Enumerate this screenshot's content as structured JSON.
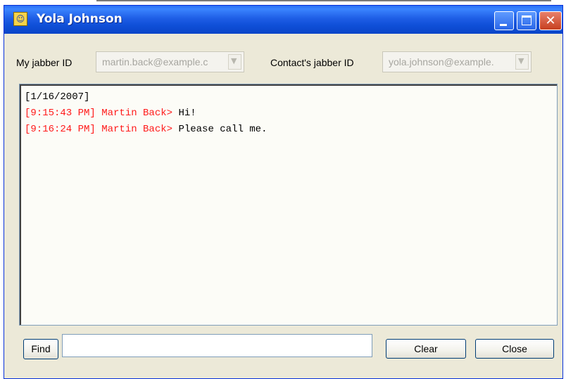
{
  "window": {
    "title": "Yola Johnson"
  },
  "fields": {
    "my_id_label": "My jabber ID",
    "my_id_value": "martin.back@example.c",
    "contact_id_label": "Contact's jabber ID",
    "contact_id_value": "yola.johnson@example."
  },
  "log": {
    "date": "[1/16/2007]",
    "messages": [
      {
        "prefix": "[9:15:43 PM] Martin Back>",
        "text": " Hi!"
      },
      {
        "prefix": "[9:16:24 PM] Martin Back>",
        "text": " Please call me."
      }
    ]
  },
  "find": {
    "label": "Find",
    "value": ""
  },
  "buttons": {
    "clear": "Clear",
    "close": "Close"
  },
  "colors": {
    "titlebar": "#0f4fd8",
    "sender": "#ff1a1a",
    "frame": "#ece9d8"
  }
}
